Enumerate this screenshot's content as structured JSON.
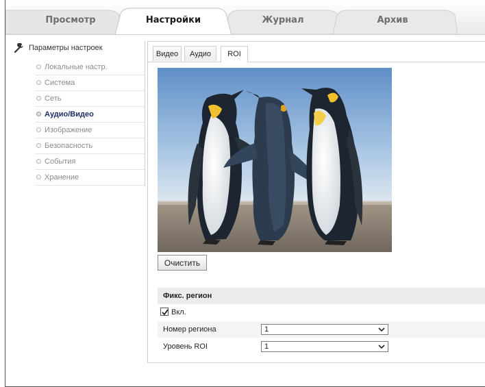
{
  "top_tabs": [
    {
      "label": "Просмотр",
      "active": false
    },
    {
      "label": "Настройки",
      "active": true
    },
    {
      "label": "Журнал",
      "active": false
    },
    {
      "label": "Архив",
      "active": false
    }
  ],
  "sidebar": {
    "header": "Параметры настроек",
    "items": [
      {
        "label": "Локальные настр.",
        "active": false
      },
      {
        "label": "Система",
        "active": false
      },
      {
        "label": "Сеть",
        "active": false
      },
      {
        "label": "Аудио/Видео",
        "active": true
      },
      {
        "label": "Изображение",
        "active": false
      },
      {
        "label": "Безопасность",
        "active": false
      },
      {
        "label": "События",
        "active": false
      },
      {
        "label": "Хранение",
        "active": false
      }
    ]
  },
  "sub_tabs": [
    {
      "label": "Видео",
      "active": false
    },
    {
      "label": "Аудио",
      "active": false
    },
    {
      "label": "ROI",
      "active": true
    }
  ],
  "preview": {
    "content": "penguins-photo"
  },
  "clear_button": "Очистить",
  "fixed_region": {
    "title": "Фикс. регион",
    "enable_label": "Вкл.",
    "enabled": true,
    "region_number_label": "Номер региона",
    "region_number_value": "1",
    "roi_level_label": "Уровень ROI",
    "roi_level_value": "1"
  },
  "colors": {
    "active_sidebar_text": "#1d2f66",
    "tab_bar_bg": "#f3f3f3",
    "section_bg": "#ececec"
  }
}
